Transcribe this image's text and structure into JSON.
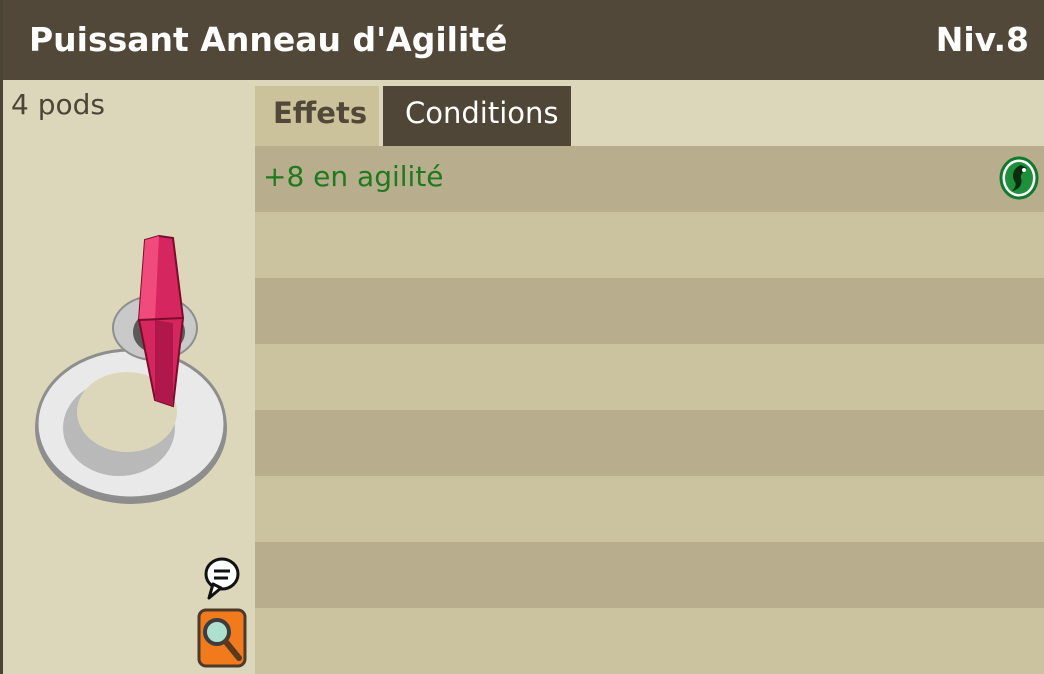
{
  "item": {
    "name": "Puissant Anneau d'Agilité",
    "level": "Niv.8",
    "weight": "4 pods",
    "image_icon": "ring-with-pink-crystal-icon"
  },
  "tabs": [
    {
      "label": "Effets",
      "active": true
    },
    {
      "label": "Conditions",
      "active": false
    }
  ],
  "effects": [
    {
      "text": "+8 en agilité",
      "icon": "agility-element-icon",
      "color": "#1f7a1f"
    },
    {
      "text": ""
    },
    {
      "text": ""
    },
    {
      "text": ""
    },
    {
      "text": ""
    },
    {
      "text": ""
    },
    {
      "text": ""
    },
    {
      "text": ""
    }
  ],
  "left_icons": {
    "chat": "speech-bubble-icon",
    "zoom": "magnifier-icon"
  },
  "colors": {
    "header_bg": "#514839",
    "panel_bg": "#dcd7ba",
    "row_dark": "#b8ad8c",
    "row_light": "#cbc29f",
    "effect_green": "#1f7a1f",
    "tab_active_bg": "#cbc19b",
    "tab_inactive_bg": "#4f4637"
  }
}
